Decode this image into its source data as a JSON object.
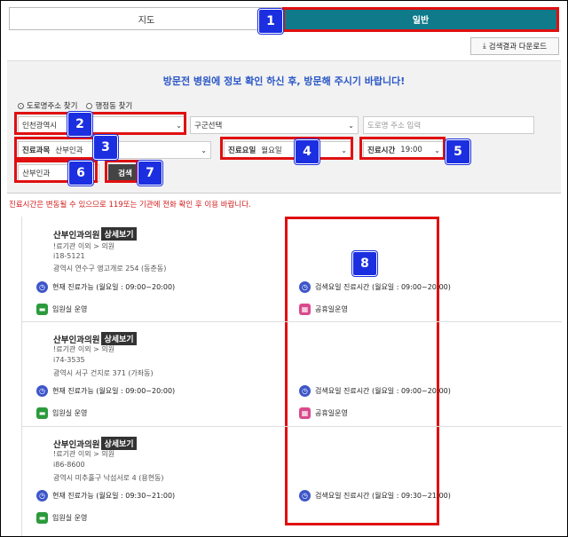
{
  "tabs": {
    "map": "지도",
    "general": "일반"
  },
  "download_label": "검색결과 다운로드",
  "notice": "방문전 병원에 정보 확인 하신 후, 방문해 주시기 바랍니다!",
  "radios": [
    {
      "label": "도로명주소 찾기",
      "checked": true
    },
    {
      "label": "행정동 찾기",
      "checked": false
    }
  ],
  "filters": {
    "city": "인천광역시",
    "district_placeholder": "구군선택",
    "road_placeholder": "도로명 주소 입력",
    "dept_label": "진료과목",
    "dept_value": "산부인과",
    "day_label": "진료요일",
    "day_value": "월요일",
    "time_label": "진료시간",
    "time_value": "19:00",
    "keyword_value": "산부인과",
    "search_label": "검색"
  },
  "badges": [
    "1",
    "2",
    "3",
    "4",
    "5",
    "6",
    "7",
    "8"
  ],
  "warning": "진료시간은 변동될 수 있으므로 119또는 기관에 전화 확인 후 이용 바랍니다.",
  "detail_label": "상세보기",
  "results": [
    {
      "name": "산부인과의원",
      "type": "!료기관 이외 > 의원",
      "phone": "i18-5121",
      "address": "광역시 연수구 앵고개로 254 (동춘동)",
      "now": "현재 진료가능 (월요일 : 09:00~20:00)",
      "search_time": "검색요일 진료시간 (월요일 : 09:00~20:00)",
      "ward": "입원실 운영",
      "holiday": "공휴일운영"
    },
    {
      "name": "산부인과의원",
      "type": "!료기관 이외 > 의원",
      "phone": "i74-3535",
      "address": "광역시 서구 건지로 371 (가좌동)",
      "now": "현재 진료가능 (월요일 : 09:00~20:00)",
      "search_time": "검색요일 진료시간 (월요일 : 09:00~20:00)",
      "ward": "입원실 운영",
      "holiday": "공휴일운영"
    },
    {
      "name": "산부인과의원",
      "type": "!료기관 이외 > 의원",
      "phone": "i86-8600",
      "address": "광역시 미추홀구 낙섬서로 4 (용현동)",
      "now": "현재 진료가능 (월요일 : 09:30~21:00)",
      "search_time": "검색요일 진료시간 (월요일 : 09:30~21:00)",
      "ward": "입원실 운영",
      "holiday": ""
    }
  ]
}
